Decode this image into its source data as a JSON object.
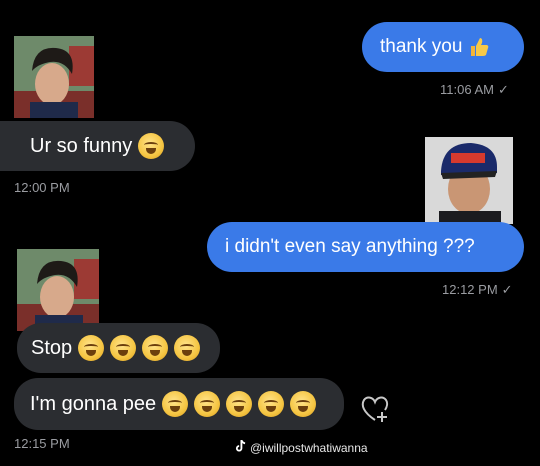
{
  "messages": [
    {
      "text": "thank you",
      "emoji": "thumbs-up"
    },
    {
      "time": "11:06 AM"
    },
    {
      "text": "Ur so funny"
    },
    {
      "time": "12:00 PM"
    },
    {
      "text": "i didn't even say anything ???"
    },
    {
      "time": "12:12 PM"
    },
    {
      "text": "Stop"
    },
    {
      "text": "I'm gonna pee"
    },
    {
      "time": "12:15 PM"
    }
  ],
  "watermark": "@iwillpostwhatiwanna",
  "icons": {
    "react": "heart-plus-icon",
    "tiktok": "tiktok-icon",
    "check": "✓"
  },
  "colors": {
    "background": "#000000",
    "outgoing_bubble": "#3a7ae8",
    "incoming_bubble": "#2b2d31",
    "timestamp": "#9a9ca1"
  }
}
